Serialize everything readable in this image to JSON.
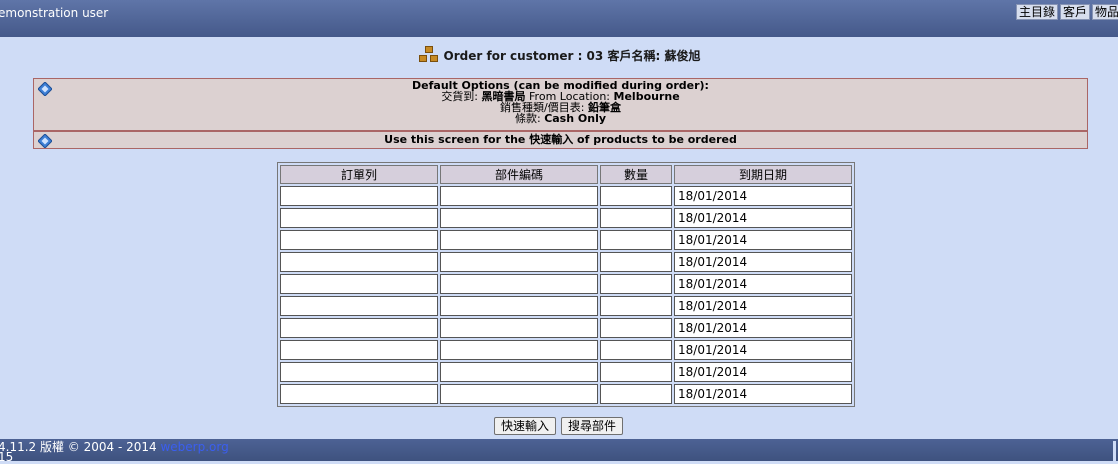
{
  "header": {
    "user_label": "emonstration user",
    "menu": [
      "主目錄",
      "客戶",
      "物品"
    ]
  },
  "title": {
    "prefix": "Order for customer : ",
    "customer_code": "03",
    "customer_name_label": "客戶名稱:",
    "customer_name": "蘇俊旭"
  },
  "defaults_panel": {
    "heading": "Default Options (can be modified during order):",
    "deliver_to_label": "交貨到:",
    "deliver_to_value": "黑暗書局",
    "from_location_label": "From Location:",
    "from_location_value": "Melbourne",
    "sales_type_label": "銷售種類/價目表:",
    "sales_type_value": "鉛筆盒",
    "terms_label": "條款:",
    "terms_value": "Cash Only"
  },
  "hint_panel": {
    "before": "Use this screen for the ",
    "highlight": "快速輸入",
    "after": " of products to be ordered"
  },
  "table": {
    "headers": [
      "訂單列",
      "部件編碼",
      "數量",
      "到期日期"
    ],
    "rows": [
      {
        "order_line": "",
        "part_code": "",
        "quantity": "",
        "due_date": "18/01/2014"
      },
      {
        "order_line": "",
        "part_code": "",
        "quantity": "",
        "due_date": "18/01/2014"
      },
      {
        "order_line": "",
        "part_code": "",
        "quantity": "",
        "due_date": "18/01/2014"
      },
      {
        "order_line": "",
        "part_code": "",
        "quantity": "",
        "due_date": "18/01/2014"
      },
      {
        "order_line": "",
        "part_code": "",
        "quantity": "",
        "due_date": "18/01/2014"
      },
      {
        "order_line": "",
        "part_code": "",
        "quantity": "",
        "due_date": "18/01/2014"
      },
      {
        "order_line": "",
        "part_code": "",
        "quantity": "",
        "due_date": "18/01/2014"
      },
      {
        "order_line": "",
        "part_code": "",
        "quantity": "",
        "due_date": "18/01/2014"
      },
      {
        "order_line": "",
        "part_code": "",
        "quantity": "",
        "due_date": "18/01/2014"
      },
      {
        "order_line": "",
        "part_code": "",
        "quantity": "",
        "due_date": "18/01/2014"
      }
    ]
  },
  "buttons": {
    "quick_entry": "快速輸入",
    "search_parts": "搜尋部件"
  },
  "footer": {
    "version_text": "4.11.2 版權 © 2004 - 2014 ",
    "link_text": "weberp.org",
    "line2": "15"
  },
  "colors": {
    "background": "#cfdcf6",
    "header": "#4d6295",
    "panel": "#dcd1d1",
    "panel_border": "#aa6666",
    "link": "#3a5ef0"
  },
  "icons": {
    "title_icon": "boxes-icon",
    "panel_icon": "help-icon"
  }
}
